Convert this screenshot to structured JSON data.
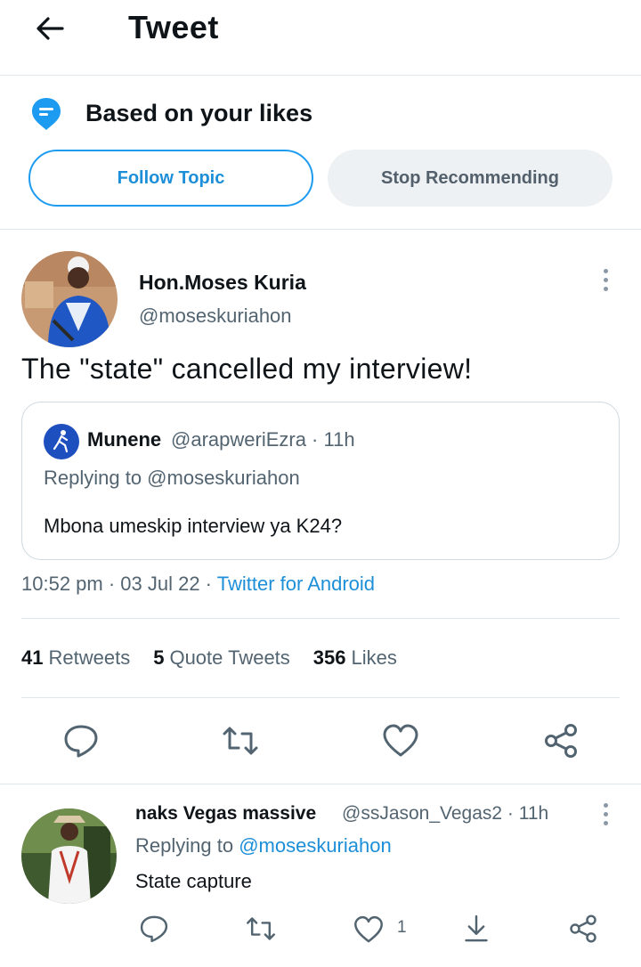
{
  "header": {
    "title": "Tweet",
    "back_icon": "arrow-left-icon"
  },
  "topic": {
    "title": "Based on your likes",
    "follow_label": "Follow Topic",
    "stop_label": "Stop Recommending"
  },
  "tweet": {
    "author_name": "Hon.Moses Kuria",
    "author_handle": "@moseskuriahon",
    "text": "The \"state\" cancelled my interview!",
    "quoted": {
      "name": "Munene",
      "handle_time": "@arapweriEzra · 11h",
      "replying": "Replying to @moseskuriahon",
      "text": "Mbona umeskip interview ya K24?"
    },
    "meta_time": "10:52 pm · 03 Jul 22 · ",
    "meta_source": "Twitter for Android",
    "stats": {
      "retweets_count": "41",
      "retweets_label": "Retweets",
      "quotes_count": "5",
      "quotes_label": "Quote Tweets",
      "likes_count": "356",
      "likes_label": "Likes"
    }
  },
  "reply": {
    "name": "naks Vegas massive",
    "handle_time": "@ssJason_Vegas2 · 11h",
    "replying_prefix": "Replying to ",
    "replying_handle": "@moseskuriahon",
    "text": "State capture",
    "like_count": "1"
  },
  "colors": {
    "accent": "#1d9bf0",
    "muted": "#536471",
    "divider": "#e1e6ea"
  }
}
